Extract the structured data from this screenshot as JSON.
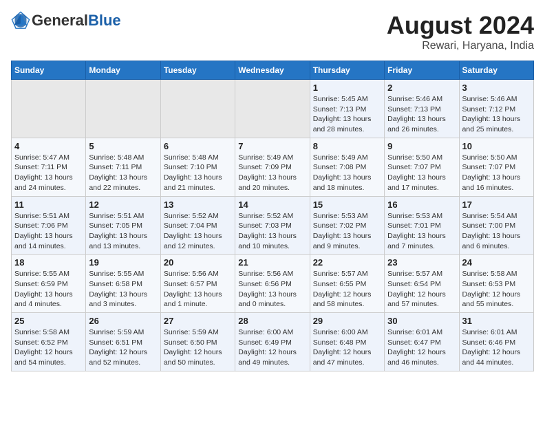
{
  "header": {
    "logo_general": "General",
    "logo_blue": "Blue",
    "title": "August 2024",
    "subtitle": "Rewari, Haryana, India"
  },
  "weekdays": [
    "Sunday",
    "Monday",
    "Tuesday",
    "Wednesday",
    "Thursday",
    "Friday",
    "Saturday"
  ],
  "weeks": [
    [
      {
        "day": "",
        "info": ""
      },
      {
        "day": "",
        "info": ""
      },
      {
        "day": "",
        "info": ""
      },
      {
        "day": "",
        "info": ""
      },
      {
        "day": "1",
        "info": "Sunrise: 5:45 AM\nSunset: 7:13 PM\nDaylight: 13 hours\nand 28 minutes."
      },
      {
        "day": "2",
        "info": "Sunrise: 5:46 AM\nSunset: 7:13 PM\nDaylight: 13 hours\nand 26 minutes."
      },
      {
        "day": "3",
        "info": "Sunrise: 5:46 AM\nSunset: 7:12 PM\nDaylight: 13 hours\nand 25 minutes."
      }
    ],
    [
      {
        "day": "4",
        "info": "Sunrise: 5:47 AM\nSunset: 7:11 PM\nDaylight: 13 hours\nand 24 minutes."
      },
      {
        "day": "5",
        "info": "Sunrise: 5:48 AM\nSunset: 7:11 PM\nDaylight: 13 hours\nand 22 minutes."
      },
      {
        "day": "6",
        "info": "Sunrise: 5:48 AM\nSunset: 7:10 PM\nDaylight: 13 hours\nand 21 minutes."
      },
      {
        "day": "7",
        "info": "Sunrise: 5:49 AM\nSunset: 7:09 PM\nDaylight: 13 hours\nand 20 minutes."
      },
      {
        "day": "8",
        "info": "Sunrise: 5:49 AM\nSunset: 7:08 PM\nDaylight: 13 hours\nand 18 minutes."
      },
      {
        "day": "9",
        "info": "Sunrise: 5:50 AM\nSunset: 7:07 PM\nDaylight: 13 hours\nand 17 minutes."
      },
      {
        "day": "10",
        "info": "Sunrise: 5:50 AM\nSunset: 7:07 PM\nDaylight: 13 hours\nand 16 minutes."
      }
    ],
    [
      {
        "day": "11",
        "info": "Sunrise: 5:51 AM\nSunset: 7:06 PM\nDaylight: 13 hours\nand 14 minutes."
      },
      {
        "day": "12",
        "info": "Sunrise: 5:51 AM\nSunset: 7:05 PM\nDaylight: 13 hours\nand 13 minutes."
      },
      {
        "day": "13",
        "info": "Sunrise: 5:52 AM\nSunset: 7:04 PM\nDaylight: 13 hours\nand 12 minutes."
      },
      {
        "day": "14",
        "info": "Sunrise: 5:52 AM\nSunset: 7:03 PM\nDaylight: 13 hours\nand 10 minutes."
      },
      {
        "day": "15",
        "info": "Sunrise: 5:53 AM\nSunset: 7:02 PM\nDaylight: 13 hours\nand 9 minutes."
      },
      {
        "day": "16",
        "info": "Sunrise: 5:53 AM\nSunset: 7:01 PM\nDaylight: 13 hours\nand 7 minutes."
      },
      {
        "day": "17",
        "info": "Sunrise: 5:54 AM\nSunset: 7:00 PM\nDaylight: 13 hours\nand 6 minutes."
      }
    ],
    [
      {
        "day": "18",
        "info": "Sunrise: 5:55 AM\nSunset: 6:59 PM\nDaylight: 13 hours\nand 4 minutes."
      },
      {
        "day": "19",
        "info": "Sunrise: 5:55 AM\nSunset: 6:58 PM\nDaylight: 13 hours\nand 3 minutes."
      },
      {
        "day": "20",
        "info": "Sunrise: 5:56 AM\nSunset: 6:57 PM\nDaylight: 13 hours\nand 1 minute."
      },
      {
        "day": "21",
        "info": "Sunrise: 5:56 AM\nSunset: 6:56 PM\nDaylight: 13 hours\nand 0 minutes."
      },
      {
        "day": "22",
        "info": "Sunrise: 5:57 AM\nSunset: 6:55 PM\nDaylight: 12 hours\nand 58 minutes."
      },
      {
        "day": "23",
        "info": "Sunrise: 5:57 AM\nSunset: 6:54 PM\nDaylight: 12 hours\nand 57 minutes."
      },
      {
        "day": "24",
        "info": "Sunrise: 5:58 AM\nSunset: 6:53 PM\nDaylight: 12 hours\nand 55 minutes."
      }
    ],
    [
      {
        "day": "25",
        "info": "Sunrise: 5:58 AM\nSunset: 6:52 PM\nDaylight: 12 hours\nand 54 minutes."
      },
      {
        "day": "26",
        "info": "Sunrise: 5:59 AM\nSunset: 6:51 PM\nDaylight: 12 hours\nand 52 minutes."
      },
      {
        "day": "27",
        "info": "Sunrise: 5:59 AM\nSunset: 6:50 PM\nDaylight: 12 hours\nand 50 minutes."
      },
      {
        "day": "28",
        "info": "Sunrise: 6:00 AM\nSunset: 6:49 PM\nDaylight: 12 hours\nand 49 minutes."
      },
      {
        "day": "29",
        "info": "Sunrise: 6:00 AM\nSunset: 6:48 PM\nDaylight: 12 hours\nand 47 minutes."
      },
      {
        "day": "30",
        "info": "Sunrise: 6:01 AM\nSunset: 6:47 PM\nDaylight: 12 hours\nand 46 minutes."
      },
      {
        "day": "31",
        "info": "Sunrise: 6:01 AM\nSunset: 6:46 PM\nDaylight: 12 hours\nand 44 minutes."
      }
    ]
  ]
}
